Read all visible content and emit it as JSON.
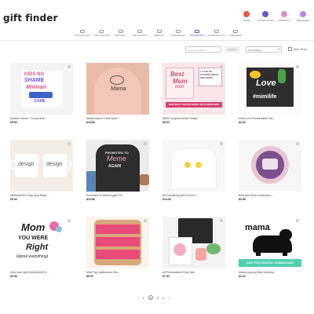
{
  "header": {
    "logo_text": "gift finder",
    "icons": [
      {
        "label": "HOME",
        "icon": "home-icon",
        "color": "#e2574c"
      },
      {
        "label": "NOTIFICATION",
        "icon": "bell-icon",
        "color": "#6a5acd"
      },
      {
        "label": "WISHLIST",
        "icon": "heart-icon",
        "color": "#d88fd0"
      },
      {
        "label": "MESSAGES",
        "icon": "chat-icon",
        "color": "#b48ae0"
      }
    ]
  },
  "categories": [
    {
      "label": "MOTHERS DAY"
    },
    {
      "label": "BABY SHOWER"
    },
    {
      "label": "BIRTHDAY"
    },
    {
      "label": "GRADUATION"
    },
    {
      "label": "WEDDING"
    },
    {
      "label": "ANNIVERSARY"
    },
    {
      "label": "RETIREMENT"
    },
    {
      "label": "VALENTINES DAY"
    },
    {
      "label": "CHRISTMAS"
    }
  ],
  "filters": {
    "search_placeholder": "Find your results",
    "search_button": "Search",
    "price_label": "Price Range",
    "more_views_label": "More Views"
  },
  "products": [
    {
      "title": "Minivan Game - Funny Moth...",
      "price": "$5.50"
    },
    {
      "title": "Mama Mama T-shirt Moth...",
      "price": "$19.83"
    },
    {
      "title": "MUM Coupons Book Printab...",
      "price": "$5.00"
    },
    {
      "title": "Mimi Love Grandmother Sw...",
      "price": "$3.00"
    },
    {
      "title": "Mother&#39;s Day Mug Mock...",
      "price": "$5.00"
    },
    {
      "title": "Promoted To Meme Again Sh...",
      "price": "$19.98"
    },
    {
      "title": "Be Everything Bee Kind Gu...",
      "price": "$14.49"
    },
    {
      "title": "Best Mom Ever sublimatio...",
      "price": "$3.95"
    },
    {
      "title": "Mom was right Mother&#39;S...",
      "price": "$3.99"
    },
    {
      "title": "Mini Png Sublimation Des...",
      "price": "$5.00"
    },
    {
      "title": "All Personalized Easy Nat...",
      "price": "$7.50"
    },
    {
      "title": "Mama png svg Bear Mothers...",
      "price": "$2.24"
    }
  ],
  "product_artwork_text": {
    "p1": [
      "KIDS NO",
      "SHAME",
      "Minivan",
      "GAME"
    ],
    "p2": [
      "Mama"
    ],
    "p3": [
      "Best",
      "Mum",
      "ever",
      "EDITABLE COUPON BOOK WITH ENVELOPE",
      "1 X4 BLUR COUPON IDEAS INCLUDED!"
    ],
    "p4": [
      "Love",
      "#mimilife"
    ],
    "p5": [
      "design",
      "design"
    ],
    "p6": [
      "PROMOTED TO",
      "Meme",
      "AGAIN"
    ],
    "p7": [],
    "p8": [],
    "p9": [
      "Mom",
      "YOU WERE",
      "Right",
      "(about everything)"
    ],
    "p10": [],
    "p11": [],
    "p12": [
      "mama",
      "SVG PNG DIGITAL DOWNLOAD"
    ]
  },
  "pagination": {
    "pages": [
      "‹",
      "1",
      "2",
      "3",
      "4",
      "›"
    ],
    "current": "2"
  }
}
